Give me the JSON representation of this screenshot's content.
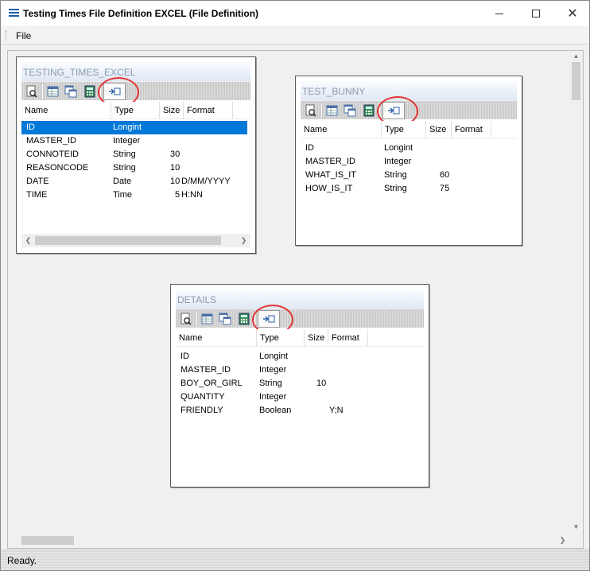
{
  "window": {
    "title": "Testing Times File Definition EXCEL (File Definition)",
    "minimize_glyph": "",
    "maximize_glyph": "",
    "close_glyph": "✕"
  },
  "menubar": {
    "file": "File"
  },
  "status": {
    "text": "Ready."
  },
  "icons": {
    "app": "list-icon",
    "toolbar": [
      "preview-icon",
      "table-view-icon",
      "copy-table-icon",
      "calculator-icon",
      "insert-field-icon"
    ]
  },
  "accent": "#0078d7",
  "annotation_color": "#e33434",
  "tables": {
    "testing_times_excel": {
      "title": "TESTING_TIMES_EXCEL",
      "columns": {
        "name": "Name",
        "type": "Type",
        "size": "Size",
        "format": "Format"
      },
      "selected_row": 0,
      "rows": [
        {
          "name": "ID",
          "type": "Longint",
          "size": "",
          "format": ""
        },
        {
          "name": "MASTER_ID",
          "type": "Integer",
          "size": "",
          "format": ""
        },
        {
          "name": "CONNOTEID",
          "type": "String",
          "size": "30",
          "format": ""
        },
        {
          "name": "REASONCODE",
          "type": "String",
          "size": "10",
          "format": ""
        },
        {
          "name": "DATE",
          "type": "Date",
          "size": "10",
          "format": "D/MM/YYYY"
        },
        {
          "name": "TIME",
          "type": "Time",
          "size": "5",
          "format": "H:NN"
        }
      ]
    },
    "test_bunny": {
      "title": "TEST_BUNNY",
      "columns": {
        "name": "Name",
        "type": "Type",
        "size": "Size",
        "format": "Format"
      },
      "rows": [
        {
          "name": "ID",
          "type": "Longint",
          "size": "",
          "format": ""
        },
        {
          "name": "MASTER_ID",
          "type": "Integer",
          "size": "",
          "format": ""
        },
        {
          "name": "WHAT_IS_IT",
          "type": "String",
          "size": "60",
          "format": ""
        },
        {
          "name": "HOW_IS_IT",
          "type": "String",
          "size": "75",
          "format": ""
        }
      ]
    },
    "details": {
      "title": "DETAILS",
      "columns": {
        "name": "Name",
        "type": "Type",
        "size": "Size",
        "format": "Format"
      },
      "rows": [
        {
          "name": "ID",
          "type": "Longint",
          "size": "",
          "format": ""
        },
        {
          "name": "MASTER_ID",
          "type": "Integer",
          "size": "",
          "format": ""
        },
        {
          "name": "BOY_OR_GIRL",
          "type": "String",
          "size": "10",
          "format": ""
        },
        {
          "name": "QUANTITY",
          "type": "Integer",
          "size": "",
          "format": ""
        },
        {
          "name": "FRIENDLY",
          "type": "Boolean",
          "size": "",
          "format": "Y;N"
        }
      ]
    }
  }
}
